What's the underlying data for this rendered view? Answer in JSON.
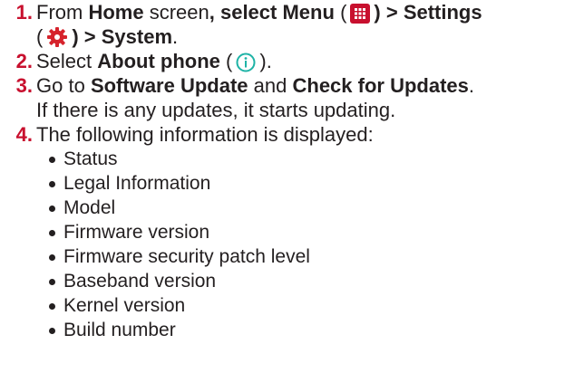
{
  "steps": [
    {
      "number": "1.",
      "parts": {
        "from": "From",
        "home": "Home",
        "screen": "screen",
        "comma_select": ", select",
        "menu": "Menu",
        "paren_open_1": "(",
        "paren_close_gt": ") >",
        "settings": "Settings",
        "paren_open_2": "(",
        "paren_close_gt_2": ") >",
        "system": "System",
        "period": "."
      },
      "icons": [
        "grid-menu-icon",
        "settings-gear-icon"
      ]
    },
    {
      "number": "2.",
      "parts": {
        "select": "Select",
        "about_phone": "About phone",
        "paren_open": "(",
        "paren_close": ").",
        "icon": "info-icon"
      }
    },
    {
      "number": "3.",
      "parts": {
        "go_to": "Go to",
        "software_update": "Software Update",
        "and": "and",
        "check_updates": "Check for Updates",
        "period": ".",
        "line2": "If there is any updates, it starts updating."
      }
    },
    {
      "number": "4.",
      "parts": {
        "text": "The following information is displayed:"
      },
      "items": [
        "Status",
        "Legal Information",
        "Model",
        "Firmware version",
        "Firmware security patch level",
        "Baseband version",
        "Kernel version",
        "Build number"
      ]
    }
  ],
  "colors": {
    "step_number": "#c8102e",
    "text": "#231f20",
    "menu_icon_bg": "#c8102e",
    "gear_icon": "#d6232c",
    "info_icon": "#1eb3a6"
  }
}
